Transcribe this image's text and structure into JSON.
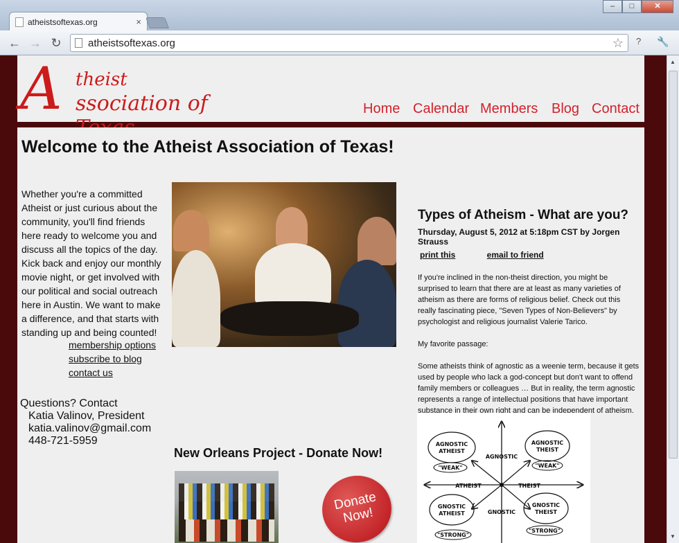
{
  "browser": {
    "tab_title": "atheistsoftexas.org",
    "tab_close": "×",
    "url": "atheistsoftexas.org",
    "window_buttons": {
      "minimize": "–",
      "maximize": "□",
      "close": "✕"
    },
    "toolbar": {
      "back": "←",
      "forward": "→",
      "reload": "↻",
      "star": "☆",
      "page": "?",
      "wrench": "🔧"
    }
  },
  "site": {
    "logo": {
      "initial_a": "A",
      "line1": "theist",
      "initial_second": "A",
      "line2": "ssociation of Texas"
    },
    "nav": [
      "Home",
      "Calendar",
      "Members",
      "Blog",
      "Contact"
    ],
    "colors": {
      "accent": "#cc1b1b",
      "frame": "#4a0a0c",
      "panel": "#efefef"
    }
  },
  "main": {
    "welcome_title": "Welcome to the Atheist Association of Texas!",
    "intro_text": "Whether you're a committed Atheist or just curious about the community, you'll find friends here ready to welcome you and discuss all the topics of the day. Kick back and enjoy our monthly movie night, or get involved with our political and social outreach here in Austin. We want to make a difference, and that starts with standing up and being counted!",
    "links": [
      "membership options",
      "subscribe to blog",
      "contact us"
    ],
    "questions": {
      "heading": "Questions? Contact",
      "name": "Katia Valinov, President",
      "email": "katia.valinov@gmail.com",
      "phone": "448-721-5959"
    },
    "new_orleans_title": "New Orleans Project - Donate Now!",
    "donate_button": {
      "line1": "Donate",
      "line2": "Now!"
    }
  },
  "article": {
    "title": "Types of Atheism - What are you?",
    "byline": "Thursday, August 5, 2012 at 5:18pm CST by Jorgen Strauss",
    "print_link": "print this",
    "email_link": "email to friend",
    "paragraphs": [
      "If you're inclined in the non-theist direction, you might be surprised to learn that there are at least as many varieties of atheism as there are forms of religious belief. Check out this really fascinating piece, \"Seven Types of Non-Believers\" by psychologist and religious journalist Valerie Tarico.",
      "My favorite passage:",
      "Some atheists think of agnostic as a weenie term, because it gets used by people who lack a god-concept but don't want to offend family members or colleagues … But in reality, the term agnostic represents a range of intellectual positions that have important substance in their own right and can be independent of atheism."
    ],
    "diagram_labels": {
      "agnostic_atheist": [
        "AGNOSTIC",
        "ATHEIST"
      ],
      "agnostic_theist": [
        "AGNOSTIC",
        "THEIST"
      ],
      "gnostic_atheist": [
        "GNOSTIC",
        "ATHEIST"
      ],
      "gnostic_theist": [
        "GNOSTIC",
        "THEIST"
      ],
      "weak_left": "\"WEAK\"",
      "weak_right": "\"WEAK\"",
      "strong_left": "\"STRONG\"",
      "strong_right": "\"STRONG\"",
      "axis_top": "AGNOSTIC",
      "axis_bottom": "GNOSTIC",
      "axis_left": "ATHEIST",
      "axis_right": "THEIST"
    }
  }
}
